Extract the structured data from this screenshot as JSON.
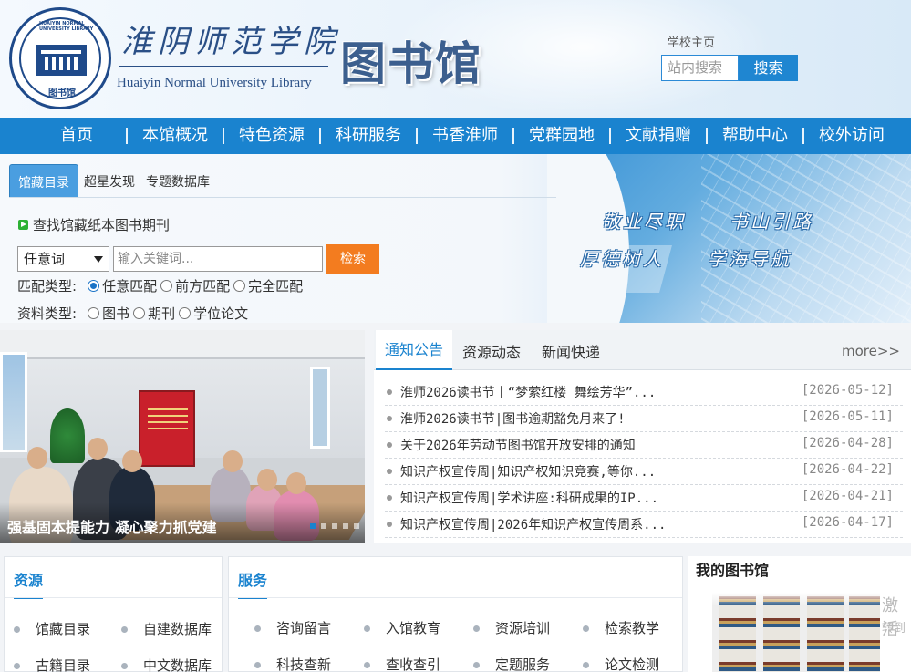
{
  "header": {
    "logo_en": "HUAIYIN NORMAL UNIVERSITY LIBRARY",
    "logo_cn": "图书馆",
    "university_name": "淮阴师范学院",
    "university_en": "Huaiyin Normal University Library",
    "library_title": "图书馆",
    "home_link": "学校主页",
    "site_search_placeholder": "站内搜索",
    "site_search_button": "搜索"
  },
  "nav": {
    "items": [
      "首页",
      "本馆概况",
      "特色资源",
      "科研服务",
      "书香淮师",
      "党群园地",
      "文献捐赠",
      "帮助中心",
      "校外访问"
    ]
  },
  "search": {
    "tabs": [
      "馆藏目录",
      "超星发现",
      "专题数据库"
    ],
    "find_title": "查找馆藏纸本图书期刊",
    "field_selected": "任意词",
    "keyword_placeholder": "输入关键词...",
    "search_button": "检索",
    "match_label": "匹配类型:",
    "match_options": [
      "任意匹配",
      "前方匹配",
      "完全匹配"
    ],
    "type_label": "资料类型:",
    "type_options": [
      "图书",
      "期刊",
      "学位论文"
    ]
  },
  "banner": {
    "slogans": [
      "敬业尽职",
      "书山引路",
      "厚德树人",
      "学海导航"
    ]
  },
  "carousel": {
    "caption": "强基固本提能力 凝心聚力抓党建"
  },
  "news": {
    "tabs": [
      "通知公告",
      "资源动态",
      "新闻快递"
    ],
    "more": "more>>",
    "items": [
      {
        "title": "淮师2026读书节丨“梦萦红楼 舞绘芳华”...",
        "date": "[2026-05-12]"
      },
      {
        "title": "淮师2026读书节|图书逾期豁免月来了!",
        "date": "[2026-05-11]"
      },
      {
        "title": "关于2026年劳动节图书馆开放安排的通知",
        "date": "[2026-04-28]"
      },
      {
        "title": "知识产权宣传周|知识产权知识竞赛,等你...",
        "date": "[2026-04-22]"
      },
      {
        "title": "知识产权宣传周|学术讲座:科研成果的IP...",
        "date": "[2026-04-21]"
      },
      {
        "title": "知识产权宣传周|2026年知识产权宣传周系...",
        "date": "[2026-04-17]"
      }
    ]
  },
  "resources": {
    "title": "资源",
    "links": [
      "馆藏目录",
      "自建数据库",
      "古籍目录",
      "中文数据库"
    ]
  },
  "services": {
    "title": "服务",
    "links": [
      "咨询留言",
      "入馆教育",
      "资源培训",
      "检索教学",
      "科技查新",
      "查收查引",
      "定题服务",
      "论文检测"
    ]
  },
  "my_library": {
    "title": "我的图书馆",
    "side_text": "激活",
    "side_text2": "转到"
  },
  "colors": {
    "nav_blue": "#1a83cf",
    "search_orange": "#f37c1f"
  }
}
